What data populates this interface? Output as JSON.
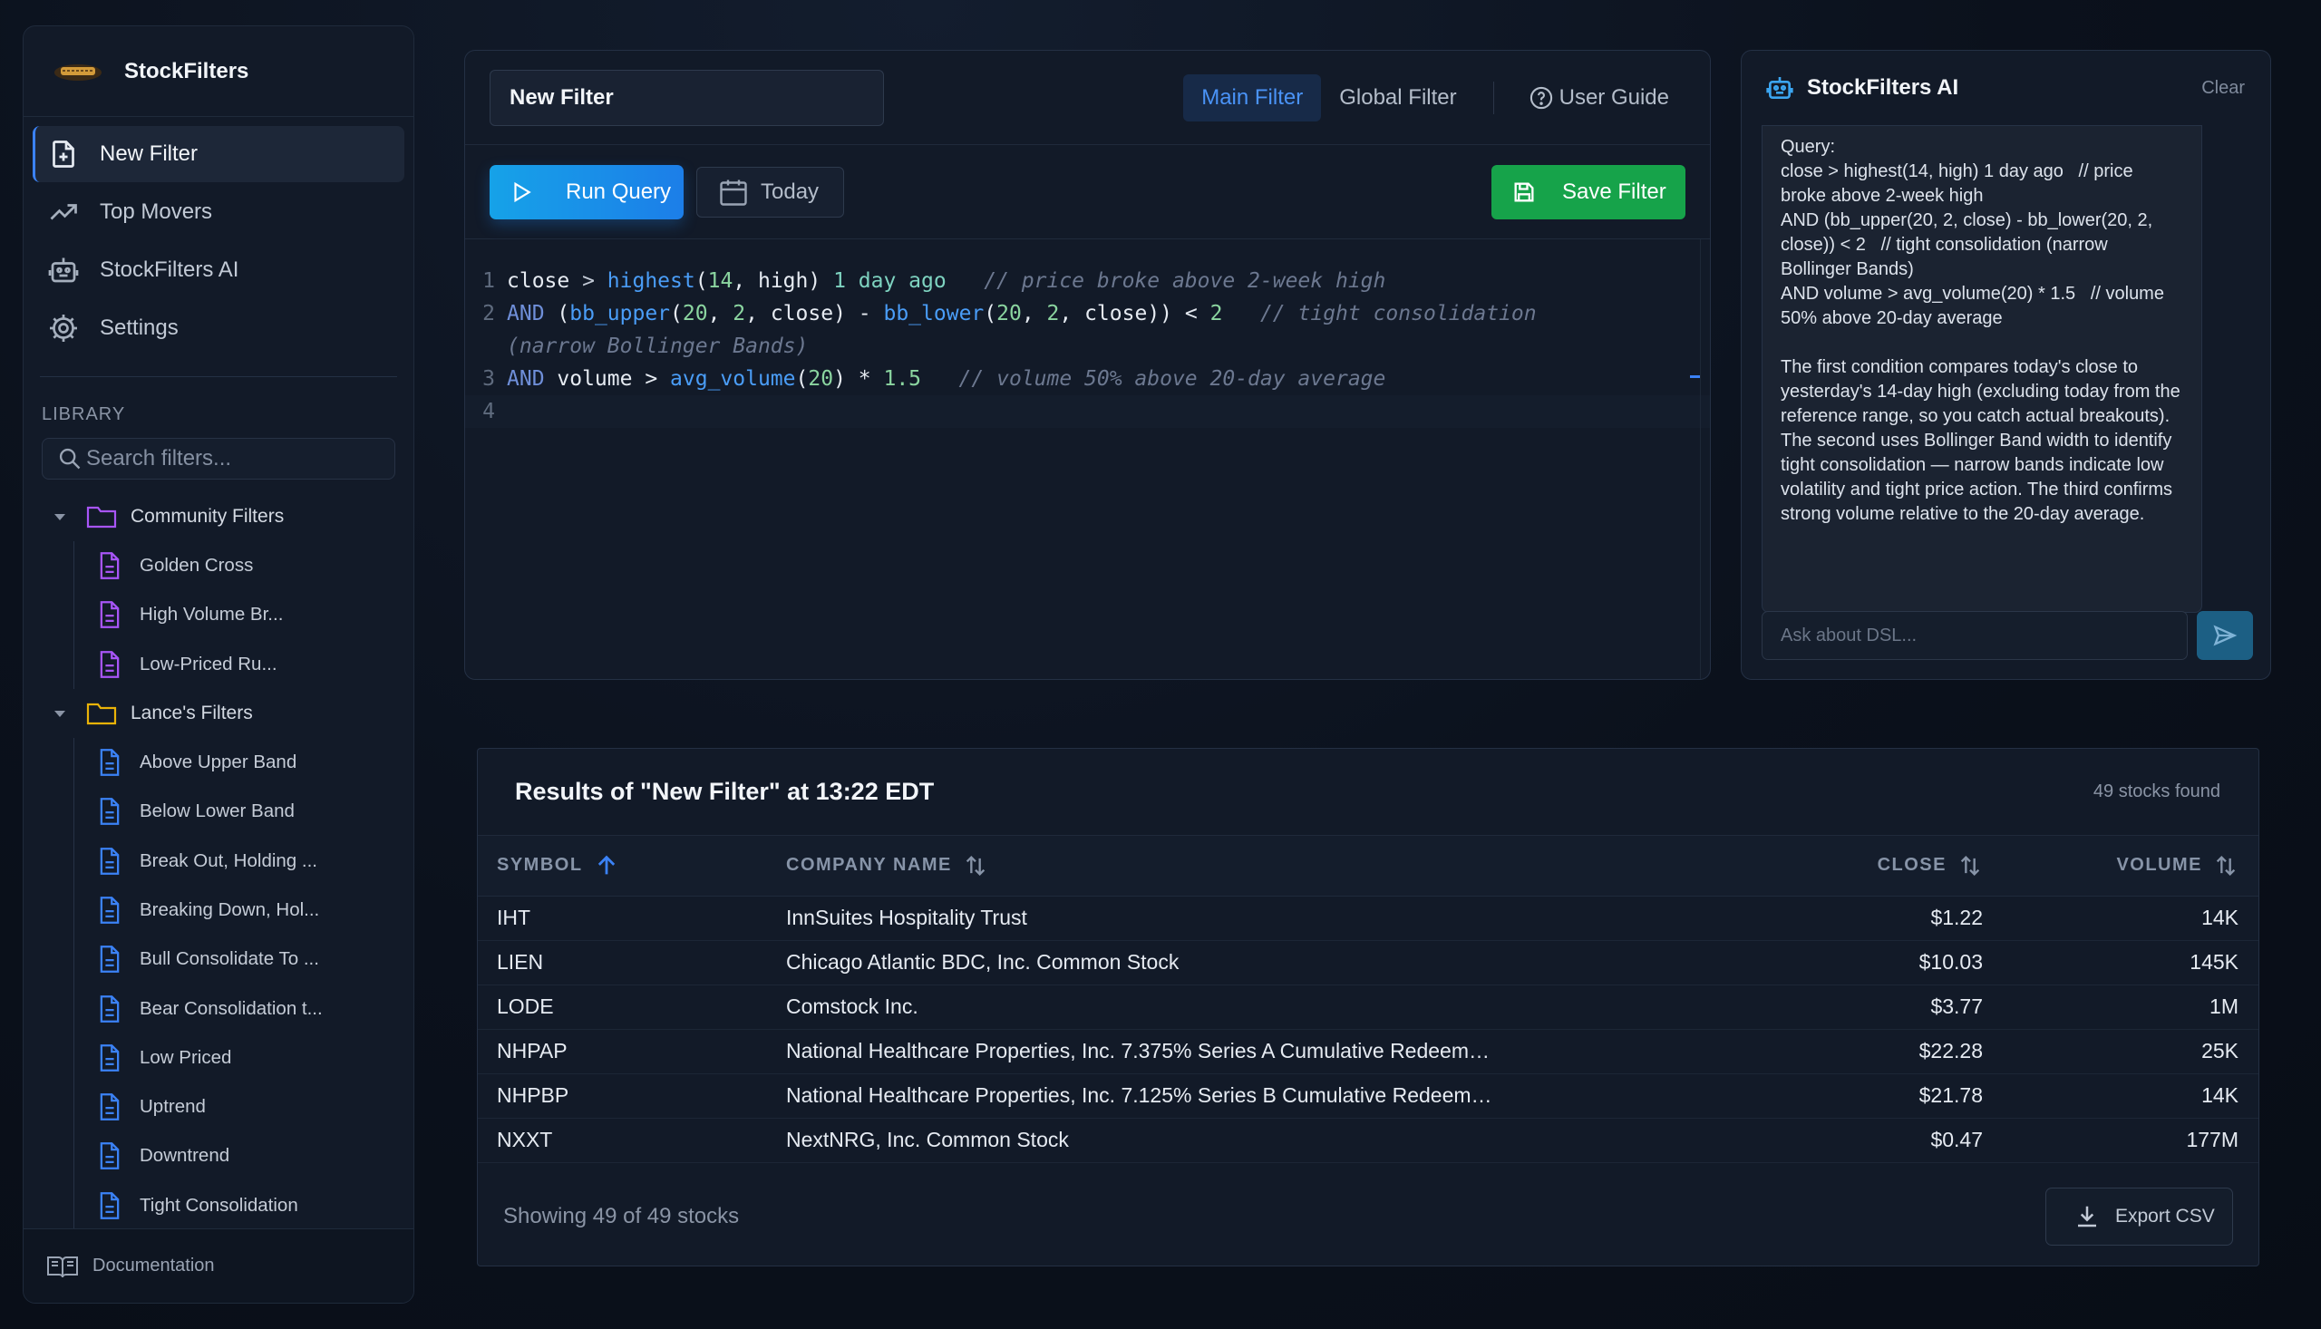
{
  "app": {
    "name": "StockFilters"
  },
  "sidebar": {
    "nav": [
      {
        "label": "New Filter",
        "icon": "file-plus-icon",
        "active": true
      },
      {
        "label": "Top Movers",
        "icon": "trending-up-icon"
      },
      {
        "label": "StockFilters AI",
        "icon": "robot-icon"
      },
      {
        "label": "Settings",
        "icon": "gear-icon"
      }
    ],
    "library_title": "LIBRARY",
    "search_placeholder": "Search filters...",
    "folders": [
      {
        "label": "Community Filters",
        "color": "#a855f7",
        "files": [
          "Golden Cross",
          "High Volume Br...",
          "Low-Priced Ru..."
        ]
      },
      {
        "label": "Lance's Filters",
        "color": "#eab308",
        "files": [
          "Above Upper Band",
          "Below Lower Band",
          "Break Out, Holding ...",
          "Breaking Down, Hol...",
          "Bull Consolidate To ...",
          "Bear Consolidation t...",
          "Low Priced",
          "Uptrend",
          "Downtrend",
          "Tight Consolidation"
        ]
      }
    ],
    "footer": "Documentation"
  },
  "editor": {
    "filter_name": "New Filter",
    "tabs": {
      "main": "Main Filter",
      "global": "Global Filter",
      "guide": "User Guide"
    },
    "run_label": "Run Query",
    "date_label": "Today",
    "save_label": "Save Filter",
    "lines": {
      "n1": "1",
      "n2": "2",
      "n3": "3",
      "n4": "4",
      "l1": {
        "a": "close",
        "b": " > ",
        "c": "highest",
        "d": "(",
        "e": "14",
        "f": ", high) ",
        "g": "1 day ago",
        "h": "   // price broke above 2-week high"
      },
      "l2": {
        "a": "AND",
        "b": " (",
        "c": "bb_upper",
        "d": "(",
        "e": "20",
        "f": ", ",
        "g": "2",
        "h": ", close) - ",
        "i": "bb_lower",
        "j": "(",
        "k": "20",
        "l": ", ",
        "m": "2",
        "n": ", close)) < ",
        "o": "2",
        "p": "   // tight consolidation",
        "q": "(narrow Bollinger Bands)"
      },
      "l3": {
        "a": "AND",
        "b": " volume > ",
        "c": "avg_volume",
        "d": "(",
        "e": "20",
        "f": ") * ",
        "g": "1.5",
        "h": "   // volume 50% above 20-day average"
      }
    }
  },
  "ai": {
    "title": "StockFilters AI",
    "clear": "Clear",
    "message_query": "Query:\nclose > highest(14, high) 1 day ago   // price broke above 2-week high\nAND (bb_upper(20, 2, close) - bb_lower(20, 2, close)) < 2   // tight consolidation (narrow Bollinger Bands)\nAND volume > avg_volume(20) * 1.5   // volume 50% above 20-day average",
    "message_explain": "The first condition compares today's close to yesterday's 14-day high (excluding today from the reference range, so you catch actual breakouts). The second uses Bollinger Band width to identify tight consolidation — narrow bands indicate low volatility and tight price action. The third confirms strong volume relative to the 20-day average.",
    "input_placeholder": "Ask about DSL..."
  },
  "results": {
    "title": "Results of \"New Filter\" at 13:22 EDT",
    "count": "49 stocks found",
    "columns": {
      "symbol": "SYMBOL",
      "company": "COMPANY NAME",
      "close": "CLOSE",
      "volume": "VOLUME"
    },
    "rows": [
      {
        "symbol": "IHT",
        "company": "InnSuites Hospitality Trust",
        "close": "$1.22",
        "volume": "14K"
      },
      {
        "symbol": "LIEN",
        "company": "Chicago Atlantic BDC, Inc. Common Stock",
        "close": "$10.03",
        "volume": "145K"
      },
      {
        "symbol": "LODE",
        "company": "Comstock Inc.",
        "close": "$3.77",
        "volume": "1M"
      },
      {
        "symbol": "NHPAP",
        "company": "National Healthcare Properties, Inc. 7.375% Series A Cumulative Redeem…",
        "close": "$22.28",
        "volume": "25K"
      },
      {
        "symbol": "NHPBP",
        "company": "National Healthcare Properties, Inc. 7.125% Series B Cumulative Redeem…",
        "close": "$21.78",
        "volume": "14K"
      },
      {
        "symbol": "NXXT",
        "company": "NextNRG, Inc. Common Stock",
        "close": "$0.47",
        "volume": "177M"
      }
    ],
    "showing": "Showing 49 of 49 stocks",
    "export_label": "Export CSV"
  }
}
